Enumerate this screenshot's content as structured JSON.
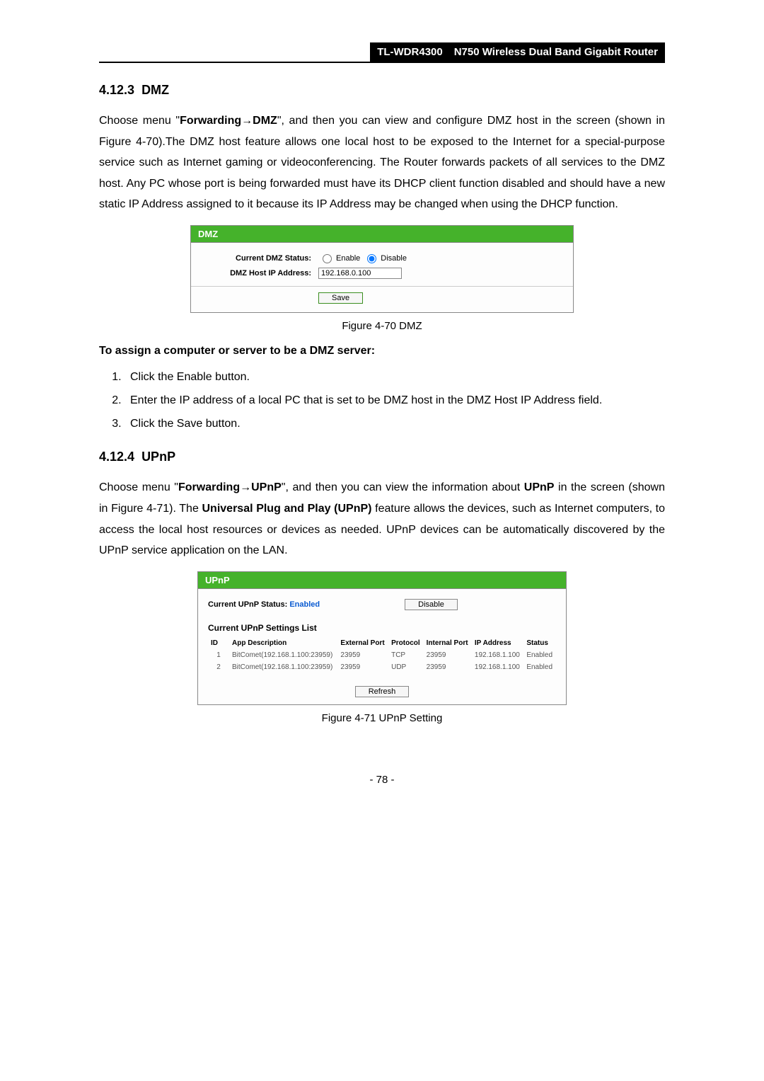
{
  "header": {
    "model": "TL-WDR4300",
    "product": "N750 Wireless Dual Band Gigabit Router"
  },
  "dmz_section": {
    "heading_num": "4.12.3",
    "heading_title": "DMZ",
    "p_pre": "Choose menu \"",
    "p_nav1": "Forwarding",
    "p_arrow": "→",
    "p_nav2": "DMZ",
    "p_post": "\", and then you can view and configure DMZ host in the screen (shown in Figure 4-70).The DMZ host feature allows one local host to be exposed to the Internet for a special-purpose service such as Internet gaming or videoconferencing. The Router forwards packets of all services to the DMZ host. Any PC whose port is being forwarded must have its DHCP client function disabled and should have a new static IP Address assigned to it because its IP Address may be changed when using the DHCP function.",
    "panel_title": "DMZ",
    "status_label": "Current DMZ Status:",
    "enable": "Enable",
    "disable": "Disable",
    "ip_label": "DMZ Host IP Address:",
    "ip_value": "192.168.0.100",
    "save": "Save",
    "caption": "Figure 4-70 DMZ",
    "assign_title": "To assign a computer or server to be a DMZ server:",
    "step1_a": "Click the ",
    "step1_b": "Enable",
    "step1_c": " button.",
    "step2_a": "Enter the IP address of a local PC that is set to be DMZ host in the ",
    "step2_b": "DMZ Host IP Address",
    "step2_c": " field.",
    "step3_a": "Click the ",
    "step3_b": "Save",
    "step3_c": " button."
  },
  "upnp_section": {
    "heading_num": "4.12.4",
    "heading_title": "UPnP",
    "p_pre": "Choose menu \"",
    "p_nav1": "Forwarding",
    "p_arrow": "→",
    "p_nav2": "UPnP",
    "p_mid1": "\", and then you can view the information about ",
    "p_bold1": "UPnP",
    "p_mid2": " in the screen (shown in Figure 4-71). The ",
    "p_bold2": "Universal Plug and Play (UPnP)",
    "p_post": " feature allows the devices, such as Internet computers, to access the local host resources or devices as needed. UPnP devices can be automatically discovered by the UPnP service application on the LAN.",
    "panel_title": "UPnP",
    "status_label": "Current UPnP Status:",
    "status_value": "Enabled",
    "disable_btn": "Disable",
    "list_title": "Current UPnP Settings List",
    "headers": {
      "id": "ID",
      "app": "App Description",
      "ext": "External Port",
      "proto": "Protocol",
      "int": "Internal Port",
      "ip": "IP Address",
      "status": "Status"
    },
    "rows": [
      {
        "id": "1",
        "app": "BitComet(192.168.1.100:23959)",
        "ext": "23959",
        "proto": "TCP",
        "int": "23959",
        "ip": "192.168.1.100",
        "status": "Enabled"
      },
      {
        "id": "2",
        "app": "BitComet(192.168.1.100:23959)",
        "ext": "23959",
        "proto": "UDP",
        "int": "23959",
        "ip": "192.168.1.100",
        "status": "Enabled"
      }
    ],
    "refresh": "Refresh",
    "caption": "Figure 4-71 UPnP Setting"
  },
  "page_number": "- 78 -"
}
